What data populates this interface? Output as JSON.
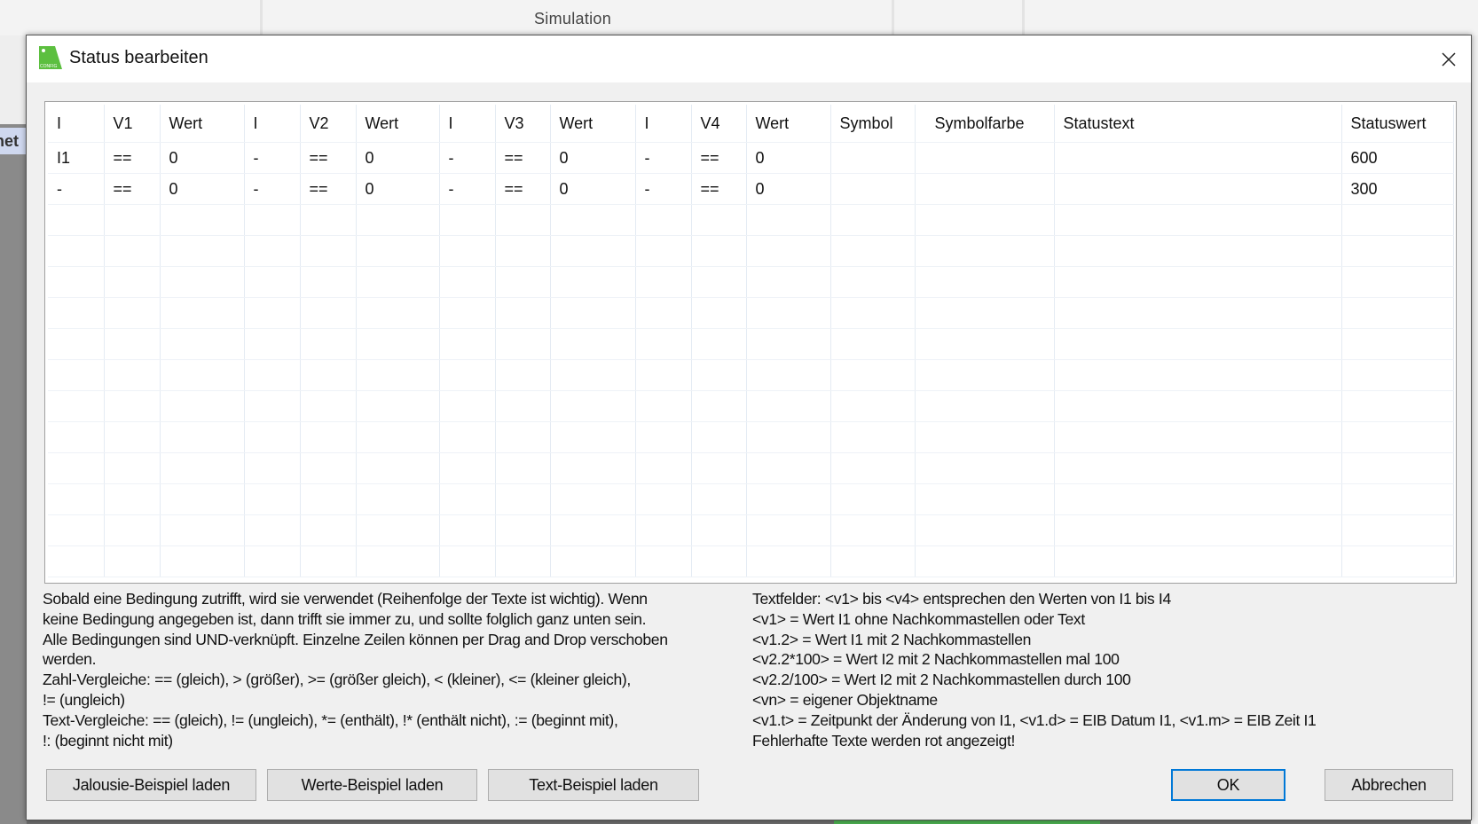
{
  "background": {
    "ribbon_label": "Simulation",
    "side_tab_label": "net"
  },
  "dialog": {
    "title": "Status bearbeiten",
    "icon_text": "CONFIG",
    "columns": [
      "I",
      "V1",
      "Wert",
      "I",
      "V2",
      "Wert",
      "I",
      "V3",
      "Wert",
      "I",
      "V4",
      "Wert",
      "Symbol",
      "Symbolfarbe",
      "Statustext",
      "Statuswert"
    ],
    "rows": [
      [
        "I1",
        "==",
        "0",
        "-",
        "==",
        "0",
        "-",
        "==",
        "0",
        "-",
        "==",
        "0",
        "",
        "",
        "",
        "600"
      ],
      [
        "-",
        "==",
        "0",
        "-",
        "==",
        "0",
        "-",
        "==",
        "0",
        "-",
        "==",
        "0",
        "",
        "",
        "",
        "300"
      ]
    ],
    "help_left": [
      "Sobald eine Bedingung zutrifft, wird sie verwendet (Reihenfolge der Texte ist wichtig). Wenn",
      "keine Bedingung angegeben ist, dann trifft sie immer zu, und sollte folglich ganz unten sein.",
      "Alle Bedingungen sind UND-verknüpft. Einzelne Zeilen können per Drag and Drop verschoben",
      "werden.",
      "Zahl-Vergleiche: == (gleich), > (größer), >= (größer gleich), < (kleiner), <= (kleiner gleich),",
      "!= (ungleich)",
      "Text-Vergleiche: == (gleich), != (ungleich), *= (enthält), !* (enthält nicht), := (beginnt mit),",
      "!: (beginnt nicht mit)"
    ],
    "help_right": [
      "Textfelder: <v1> bis <v4> entsprechen den Werten von I1 bis I4",
      "<v1> = Wert I1 ohne Nachkommastellen oder Text",
      "<v1.2> = Wert I1 mit 2 Nachkommastellen",
      "<v2.2*100> = Wert I2 mit 2 Nachkommastellen mal 100",
      "<v2.2/100> = Wert I2 mit 2 Nachkommastellen durch 100",
      "<vn> = eigener Objektname",
      "<v1.t> = Zeitpunkt der Änderung von I1, <v1.d> = EIB Datum I1, <v1.m> = EIB Zeit I1",
      "Fehlerhafte Texte werden rot angezeigt!"
    ],
    "buttons": {
      "jalousie": "Jalousie-Beispiel laden",
      "werte": "Werte-Beispiel laden",
      "text": "Text-Beispiel laden",
      "ok": "OK",
      "cancel": "Abbrechen"
    }
  }
}
